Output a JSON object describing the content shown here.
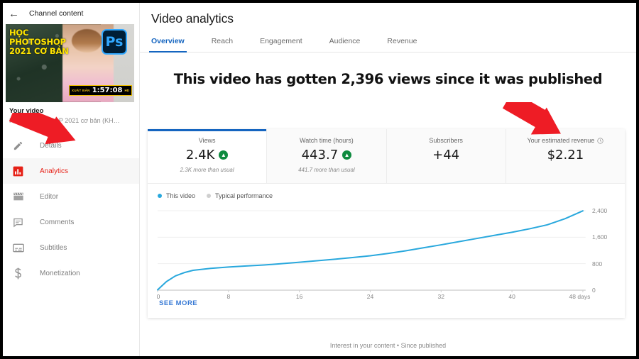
{
  "sidebar": {
    "back_icon": "back-arrow-icon",
    "channel_label": "Channel content",
    "thumbnail": {
      "title_line1": "HỌC",
      "title_line2": "PHOTOSHOP",
      "title_line3": "2021 CƠ BẢN",
      "app_badge": "Ps",
      "duration_prefix": "XUẤT BẢN",
      "duration": "1:57:08",
      "duration_suffix": "HD"
    },
    "video_owner_label": "Your video",
    "video_title": "Học PHOTOSHOP 2021 cơ bản (KH…",
    "items": [
      {
        "label": "Details",
        "icon": "pencil-icon",
        "active": false
      },
      {
        "label": "Analytics",
        "icon": "bar-chart-icon",
        "active": true
      },
      {
        "label": "Editor",
        "icon": "film-clapper-icon",
        "active": false
      },
      {
        "label": "Comments",
        "icon": "comment-bubble-icon",
        "active": false
      },
      {
        "label": "Subtitles",
        "icon": "subtitles-icon",
        "active": false
      },
      {
        "label": "Monetization",
        "icon": "dollar-sign-icon",
        "active": false
      }
    ]
  },
  "header": {
    "title": "Video analytics",
    "tabs": [
      {
        "label": "Overview",
        "active": true
      },
      {
        "label": "Reach",
        "active": false
      },
      {
        "label": "Engagement",
        "active": false
      },
      {
        "label": "Audience",
        "active": false
      },
      {
        "label": "Revenue",
        "active": false
      }
    ]
  },
  "main": {
    "headline": "This video has gotten 2,396 views since it was published",
    "metrics": [
      {
        "label": "Views",
        "value": "2.4K",
        "trend": "up",
        "subtitle": "2.3K more than usual",
        "selected": true,
        "has_info_icon": false
      },
      {
        "label": "Watch time (hours)",
        "value": "443.7",
        "trend": "up",
        "subtitle": "441.7 more than usual",
        "selected": false,
        "has_info_icon": false
      },
      {
        "label": "Subscribers",
        "value": "+44",
        "trend": "none",
        "subtitle": "",
        "selected": false,
        "has_info_icon": false
      },
      {
        "label": "Your estimated revenue",
        "value": "$2.21",
        "trend": "none",
        "subtitle": "",
        "selected": false,
        "has_info_icon": true
      }
    ],
    "see_more_label": "SEE MORE",
    "footer_note": "Interest in your content • Since published"
  },
  "colors": {
    "accent_blue": "#1565c0",
    "line_blue": "#29a8dd",
    "active_red": "#e62117",
    "trend_green": "#0d8a3e",
    "annotation_red": "#ee1c25"
  },
  "annotations": [
    {
      "name": "arrow-pointing-to-views",
      "target": "Views"
    },
    {
      "name": "arrow-pointing-to-revenue",
      "target": "Your estimated revenue"
    }
  ],
  "chart_data": {
    "type": "line",
    "title": "",
    "xlabel": "days",
    "ylabel": "",
    "xlim": [
      0,
      48
    ],
    "ylim": [
      0,
      2400
    ],
    "xticks": [
      "0",
      "8",
      "16",
      "24",
      "32",
      "40",
      "48 days"
    ],
    "xtick_values": [
      0,
      8,
      16,
      24,
      32,
      40,
      48
    ],
    "yticks": [
      "0",
      "800",
      "1,600",
      "2,400"
    ],
    "ytick_values": [
      0,
      800,
      1600,
      2400
    ],
    "grid": true,
    "legend": [
      {
        "label": "This video",
        "color": "#29a8dd"
      },
      {
        "label": "Typical performance",
        "color": "#cfcfcf"
      }
    ],
    "legend_position": "top-left",
    "series": [
      {
        "name": "This video",
        "color": "#29a8dd",
        "x": [
          0,
          1,
          2,
          3,
          4,
          6,
          8,
          10,
          12,
          14,
          16,
          18,
          20,
          22,
          24,
          26,
          28,
          30,
          32,
          34,
          36,
          38,
          40,
          42,
          44,
          46,
          48
        ],
        "values": [
          10,
          260,
          430,
          530,
          600,
          660,
          700,
          730,
          760,
          800,
          845,
          890,
          935,
          985,
          1040,
          1110,
          1190,
          1280,
          1370,
          1465,
          1560,
          1655,
          1750,
          1855,
          1975,
          2160,
          2396
        ]
      }
    ]
  }
}
